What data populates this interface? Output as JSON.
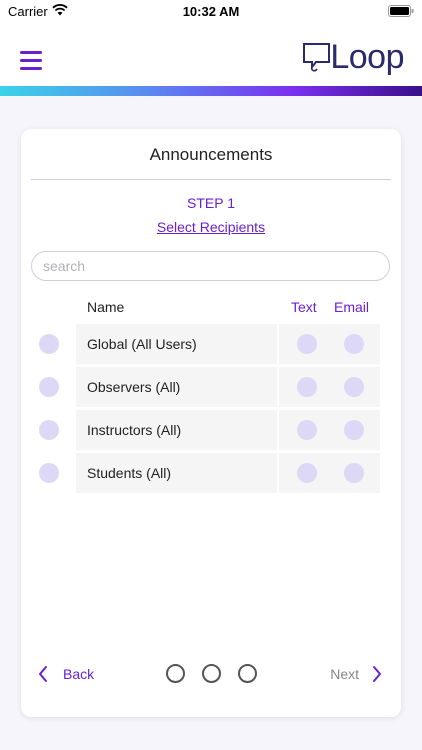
{
  "status_bar": {
    "carrier": "Carrier",
    "time": "10:32 AM"
  },
  "header": {
    "logo_text": "Loop",
    "icons": [
      "menu-icon",
      "loop-logo-icon"
    ]
  },
  "card": {
    "title": "Announcements",
    "step_label": "STEP 1",
    "step_link": "Select Recipients",
    "search": {
      "placeholder": "search",
      "value": ""
    },
    "columns": {
      "name": "Name",
      "text": "Text",
      "email": "Email"
    },
    "rows": [
      {
        "label": "Global (All Users)"
      },
      {
        "label": "Observers (All)"
      },
      {
        "label": "Instructors (All)"
      },
      {
        "label": "Students (All)"
      }
    ]
  },
  "footer": {
    "back_label": "Back",
    "next_label": "Next",
    "page_count": 3
  },
  "colors": {
    "accent": "#6a1fd0",
    "dot_fill": "#dcd8f5",
    "disabled_text": "#888888",
    "gradient": [
      "#3ad3e8",
      "#5a8af0",
      "#7a2ff0",
      "#3a0f8a"
    ]
  }
}
